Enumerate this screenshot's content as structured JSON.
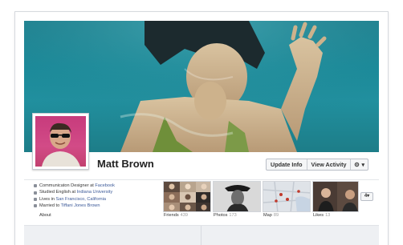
{
  "profile": {
    "name": "Matt Brown"
  },
  "actions": {
    "update_info": "Update Info",
    "view_activity": "View Activity",
    "settings_caret": "▾"
  },
  "about": {
    "label": "About",
    "items": [
      {
        "prefix": "Communicaton Designer at ",
        "link": "Facebook"
      },
      {
        "prefix": "Studied English at ",
        "link": "Indiana University"
      },
      {
        "prefix": "Lives in ",
        "link": "San Francisco, California"
      },
      {
        "prefix": "Married to ",
        "link": "Tiffani Jones Brown"
      }
    ]
  },
  "tiles": {
    "friends": {
      "label": "Friends",
      "count": "439"
    },
    "photos": {
      "label": "Photos",
      "count": "173"
    },
    "map": {
      "label": "Map",
      "count": "89"
    },
    "likes": {
      "label": "Likes",
      "count": "13"
    }
  },
  "more": {
    "label": "4"
  },
  "colors": {
    "link": "#3b5998",
    "cover_water": "#1d8898",
    "profile_bg": "#c73b7c"
  }
}
